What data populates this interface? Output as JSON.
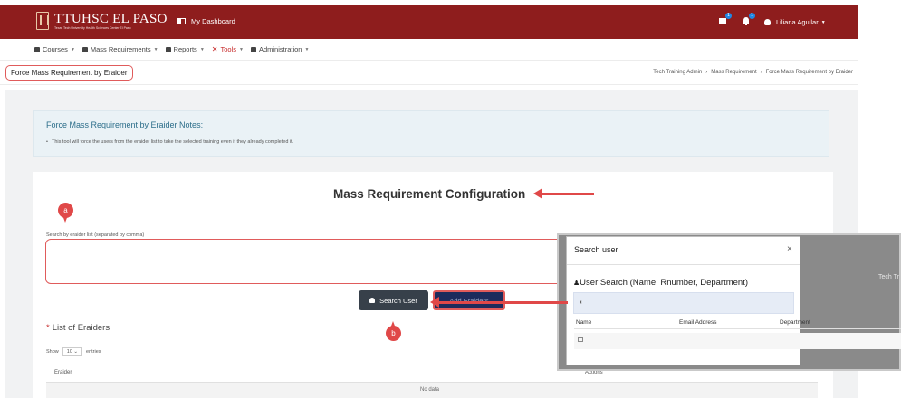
{
  "header": {
    "logo_title": "TTUHSC EL PASO",
    "logo_subtitle": "Texas Tech University Health Sciences Center El Paso",
    "dashboard_label": "My Dashboard",
    "notification_badges": [
      "1",
      "1"
    ],
    "user_name": "Liliana Aguilar"
  },
  "menu": {
    "items": [
      {
        "label": "Courses"
      },
      {
        "label": "Mass Requirements"
      },
      {
        "label": "Reports"
      },
      {
        "label": "Tools"
      },
      {
        "label": "Administration"
      }
    ]
  },
  "page": {
    "title": "Force Mass Requirement by Eraider",
    "breadcrumb": [
      "Tech Training Admin",
      "Mass Requirement",
      "Force Mass Requirement by Eraider"
    ],
    "breadcrumb_sep": "›"
  },
  "notes": {
    "title": "Force Mass Requirement by Eraider Notes:",
    "text": "This tool will force the users from the eraider list to take the selected training even if they already completed it."
  },
  "config": {
    "title": "Mass Requirement Configuration",
    "search_label": "Search by eraider list (separated by comma)",
    "search_button": "Search User",
    "add_button": "Add Eraiders",
    "list_title": "List of Eraiders",
    "list_required_mark": "*",
    "show_label": "Show",
    "entries_value": "10",
    "entries_label": "entries",
    "col_eraider": "Eraider",
    "col_actions": "Actions",
    "no_data": "No data"
  },
  "modal": {
    "title": "Search user",
    "close": "×",
    "subtitle": "User Search (Name, Rnumber, Department)",
    "col_name": "Name",
    "col_email": "Email Address",
    "col_department": "Department",
    "background_text": "Tech Tr"
  },
  "annotations": {
    "a": "a",
    "b": "b"
  },
  "colors": {
    "brand": "#8e1d1d",
    "annotation": "#e04848",
    "search_button": "#37404a"
  }
}
